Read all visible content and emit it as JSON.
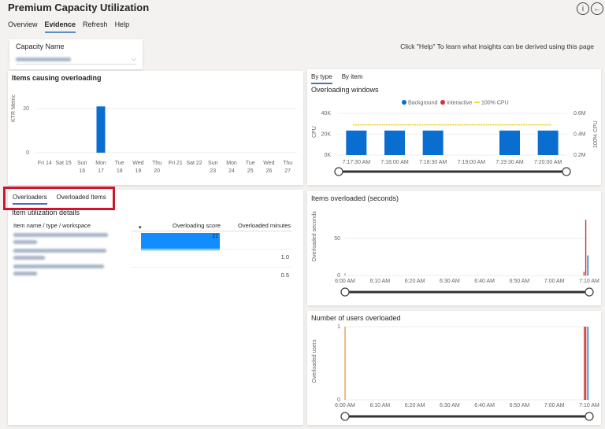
{
  "header": {
    "title": "Premium Capacity Utilization",
    "info_icon": "info-icon",
    "back_icon": "back-arrow-icon"
  },
  "nav": {
    "tabs": [
      "Overview",
      "Evidence",
      "Refresh",
      "Help"
    ],
    "active": "Evidence"
  },
  "filter": {
    "label": "Capacity Name"
  },
  "help_text": "Click \"Help\" To learn what insights can be derived using this page",
  "items_causing": {
    "title": "Items causing overloading",
    "ylabel": "KTR Metric"
  },
  "detail_tabs": [
    "Overloaders",
    "Overloaded Items"
  ],
  "detail": {
    "title": "Item utilization details",
    "columns": [
      "Item name / type / workspace",
      "Overloading score",
      "Overloaded minutes"
    ],
    "rows": [
      {
        "score": "21",
        "minutes": ""
      },
      {
        "score": "",
        "minutes": "1.0"
      },
      {
        "score": "",
        "minutes": "0.5"
      }
    ],
    "score_max": 21
  },
  "right_tabs": [
    "By type",
    "By item"
  ],
  "overloading": {
    "title": "Overloading windows",
    "legend": [
      "Background",
      "Interactive",
      "100% CPU"
    ],
    "ylabel": "CPU",
    "y2label": "100% CPU"
  },
  "items_overloaded": {
    "title": "Items overloaded (seconds)",
    "ylabel": "Overloaded seconds"
  },
  "users_overloaded": {
    "title": "Number of users overloaded",
    "ylabel": "Overloaded users"
  },
  "colors": {
    "background": "#0a6ed1",
    "interactive": "#d13438",
    "cpu100": "#f2c80f",
    "orange": "#e8a14f",
    "accent": "#118dff"
  },
  "chart_data": [
    {
      "type": "bar",
      "title": "Items causing overloading",
      "ylabel": "KTR Metric",
      "categories": [
        "Fri 14",
        "Sat 15",
        "Sun 16",
        "Mon 17",
        "Tue 18",
        "Wed 19",
        "Thu 20",
        "Fri 21",
        "Sat 22",
        "Sun 23",
        "Mon 24",
        "Tue 25",
        "Wed 26",
        "Thu 27"
      ],
      "values": [
        0,
        0,
        0,
        21,
        0,
        0,
        0,
        0,
        0,
        0,
        0,
        0,
        0,
        0
      ],
      "yticks": [
        0,
        20
      ],
      "ylim": [
        0,
        28
      ]
    },
    {
      "type": "bar",
      "title": "Overloading windows",
      "ylabel": "CPU",
      "y2label": "100% CPU",
      "categories": [
        "7:17:30 AM",
        "7:18:00 AM",
        "7:18:30 AM",
        "7:19:00 AM",
        "7:19:30 AM",
        "7:20:00 AM"
      ],
      "series": [
        {
          "name": "Background",
          "values": [
            23500,
            23500,
            23500,
            0,
            23500,
            23500
          ]
        },
        {
          "name": "Interactive",
          "values": [
            0,
            0,
            0,
            0,
            0,
            0
          ]
        },
        {
          "name": "100% CPU",
          "axis": "right",
          "values": [
            490000,
            490000,
            490000,
            490000,
            490000,
            490000
          ]
        }
      ],
      "yticks": [
        "0K",
        "20K",
        "40K"
      ],
      "ylim": [
        0,
        40000
      ],
      "y2ticks": [
        "0.2M",
        "0.4M",
        "0.6M"
      ],
      "y2lim": [
        200000,
        600000
      ],
      "legend": "top"
    },
    {
      "type": "bar",
      "title": "Items overloaded (seconds)",
      "ylabel": "Overloaded seconds",
      "xticks": [
        "6:00 AM",
        "6:10 AM",
        "6:20 AM",
        "6:30 AM",
        "6:40 AM",
        "6:50 AM",
        "7:00 AM",
        "7:10 AM"
      ],
      "xlim_minutes": [
        0,
        70
      ],
      "yticks": [
        0,
        50
      ],
      "ylim": [
        0,
        90
      ],
      "series": [
        {
          "color": "orange",
          "points": [
            [
              0,
              3
            ]
          ]
        },
        {
          "color": "interactive",
          "points": [
            [
              68.5,
              5
            ],
            [
              69,
              75
            ]
          ]
        },
        {
          "color": "background",
          "points": [
            [
              69.6,
              27
            ]
          ]
        }
      ]
    },
    {
      "type": "bar",
      "title": "Number of users overloaded",
      "ylabel": "Overloaded users",
      "xticks": [
        "6:00 AM",
        "6:10 AM",
        "6:20 AM",
        "6:30 AM",
        "6:40 AM",
        "6:50 AM",
        "7:00 AM",
        "7:10 AM"
      ],
      "xlim_minutes": [
        0,
        70
      ],
      "yticks": [
        0,
        1
      ],
      "ylim": [
        0,
        1
      ],
      "series": [
        {
          "color": "orange",
          "points": [
            [
              0,
              1
            ]
          ]
        },
        {
          "color": "interactive",
          "points": [
            [
              68.6,
              1
            ],
            [
              69,
              1
            ]
          ]
        },
        {
          "color": "background",
          "points": [
            [
              69.6,
              1
            ]
          ]
        }
      ]
    }
  ]
}
